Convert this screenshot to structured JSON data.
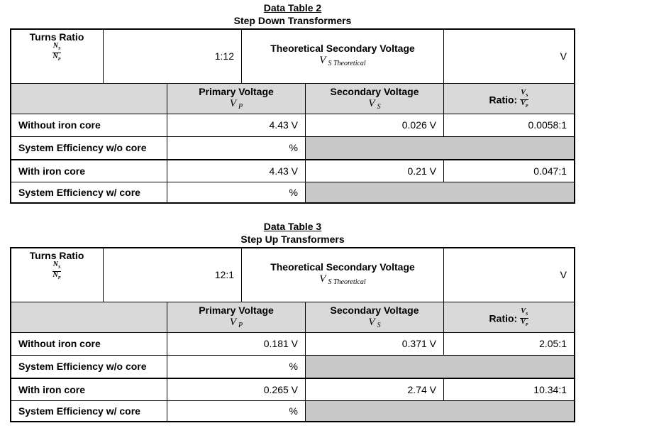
{
  "tables": [
    {
      "title": "Data Table 2",
      "subtitle": "Step Down Transformers",
      "turns_ratio_label": "Turns Ratio",
      "turns_ratio_num": "N",
      "turns_ratio_num_sub": "S",
      "turns_ratio_den": "N",
      "turns_ratio_den_sub": "P",
      "turns_ratio_value": "1:12",
      "theoretical_label": "Theoretical Secondary Voltage",
      "theoretical_symbol": "V",
      "theoretical_symbol_sub": "S Theoretical",
      "theoretical_value": "V",
      "headers": {
        "primary": "Primary Voltage",
        "primary_symbol": "V",
        "primary_symbol_sub": "P",
        "secondary": "Secondary Voltage",
        "secondary_symbol": "V",
        "secondary_symbol_sub": "S",
        "ratio": "Ratio:",
        "ratio_num": "V",
        "ratio_num_sub": "S",
        "ratio_den": "V",
        "ratio_den_sub": "P"
      },
      "rows": [
        {
          "label": "Without iron core",
          "primary": "4.43 V",
          "secondary": "0.026 V",
          "ratio": "0.0058:1"
        },
        {
          "label": "System Efficiency w/o core",
          "primary": "%"
        },
        {
          "label": "With iron core",
          "primary": "4.43 V",
          "secondary": "0.21 V",
          "ratio": "0.047:1"
        },
        {
          "label": "System Efficiency w/ core",
          "primary": "%"
        }
      ]
    },
    {
      "title": "Data Table 3",
      "subtitle": "Step Up Transformers",
      "turns_ratio_label": "Turns Ratio",
      "turns_ratio_num": "N",
      "turns_ratio_num_sub": "S",
      "turns_ratio_den": "N",
      "turns_ratio_den_sub": "P",
      "turns_ratio_value": "12:1",
      "theoretical_label": "Theoretical Secondary Voltage",
      "theoretical_symbol": "V",
      "theoretical_symbol_sub": "S Theoretical",
      "theoretical_value": "V",
      "headers": {
        "primary": "Primary Voltage",
        "primary_symbol": "V",
        "primary_symbol_sub": "P",
        "secondary": "Secondary Voltage",
        "secondary_symbol": "V",
        "secondary_symbol_sub": "S",
        "ratio": "Ratio:",
        "ratio_num": "V",
        "ratio_num_sub": "S",
        "ratio_den": "V",
        "ratio_den_sub": "P"
      },
      "rows": [
        {
          "label": "Without iron core",
          "primary": "0.181 V",
          "secondary": "0.371 V",
          "ratio": "2.05:1"
        },
        {
          "label": "System Efficiency w/o core",
          "primary": "%"
        },
        {
          "label": "With iron core",
          "primary": "0.265 V",
          "secondary": "2.74 V",
          "ratio": "10.34:1"
        },
        {
          "label": "System Efficiency w/ core",
          "primary": "%"
        }
      ]
    }
  ]
}
